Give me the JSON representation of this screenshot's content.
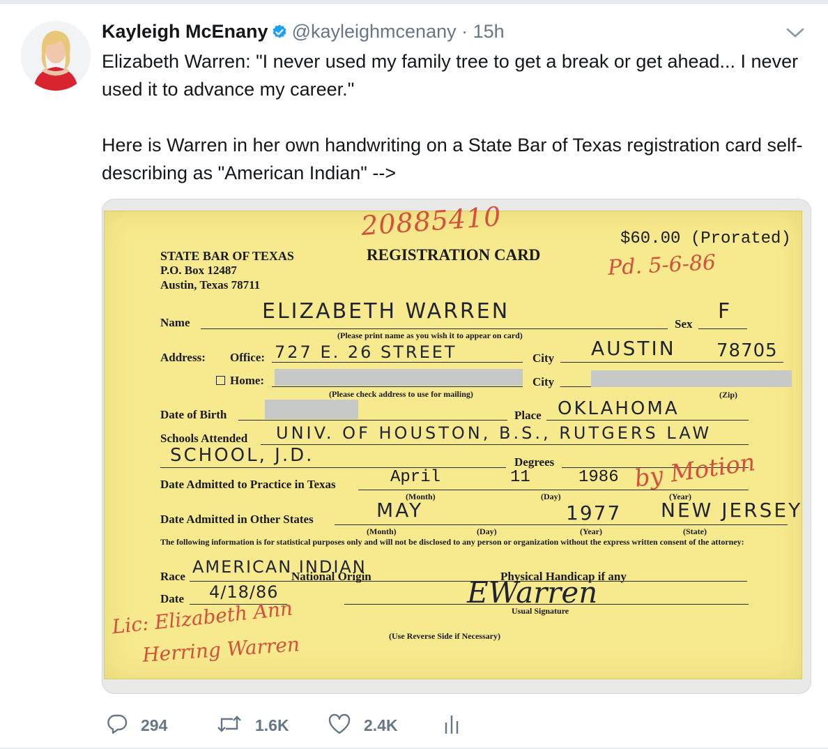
{
  "tweet": {
    "author_name": "Kayleigh McEnany",
    "handle": "@kayleighmcenany",
    "separator": "·",
    "time": "15h",
    "text": "Elizabeth Warren: \"I never used my family tree to get a break or get ahead... I never used it to advance my career.\"\n\nHere is Warren in her own handwriting on a State Bar of Texas registration card self-describing as \"American Indian\" -->"
  },
  "card": {
    "serial": "20885410",
    "org_name": "STATE BAR OF TEXAS",
    "org_box": "P.O. Box 12487",
    "org_city": "Austin, Texas 78711",
    "title": "REGISTRATION CARD",
    "fee": "$60.00 (Prorated)",
    "paid_note": "Pd. 5-6-86",
    "labels": {
      "name": "Name",
      "print_note": "(Please print name as you wish it to appear on card)",
      "sex": "Sex",
      "address": "Address:",
      "office": "Office:",
      "city": "City",
      "home": "Home:",
      "check_note": "(Please check address to use for mailing)",
      "zip": "(Zip)",
      "dob": "Date of Birth",
      "place": "Place",
      "schools": "Schools Attended",
      "degrees": "Degrees",
      "admitted_texas": "Date Admitted to Practice in Texas",
      "month": "(Month)",
      "day": "(Day)",
      "year": "(Year)",
      "admitted_other": "Date Admitted in Other States",
      "state": "(State)",
      "statistical": "The following information is for statistical purposes only and will not be disclosed to any person or organization without the express written consent of the attorney:",
      "race": "Race",
      "national_origin": "National Origin",
      "handicap": "Physical Handicap if any",
      "date": "Date",
      "usual_signature": "Usual Signature",
      "reverse": "(Use Reverse Side if Necessary)"
    },
    "values": {
      "name": "ELIZABETH WARREN",
      "sex": "F",
      "office": "727 E. 26 STREET",
      "city": "AUSTIN",
      "zip": "78705",
      "place": "OKLAHOMA",
      "schools_1": "UNIV. OF HOUSTON, B.S., RUTGERS LAW",
      "schools_2": "SCHOOL, J.D.",
      "tx_month": "April",
      "tx_day": "11",
      "tx_year": "1986",
      "by_motion": "by Motion",
      "other_month": "MAY",
      "other_year": "1977",
      "other_state": "NEW JERSEY",
      "race": "AMERICAN INDIAN",
      "date": "4/18/86",
      "signature": "EWarren",
      "lic_note_1": "Lic: Elizabeth Ann",
      "lic_note_2": "Herring Warren"
    }
  },
  "actions": {
    "replies": "294",
    "retweets": "1.6K",
    "likes": "2.4K"
  },
  "colors": {
    "verified": "#1da1f2",
    "muted": "#657786",
    "card_bg": "#f7e98d",
    "red_ink": "#d4503c"
  },
  "icons": [
    "verified-badge-icon",
    "chevron-down-icon",
    "reply-icon",
    "retweet-icon",
    "like-icon",
    "analytics-icon"
  ]
}
